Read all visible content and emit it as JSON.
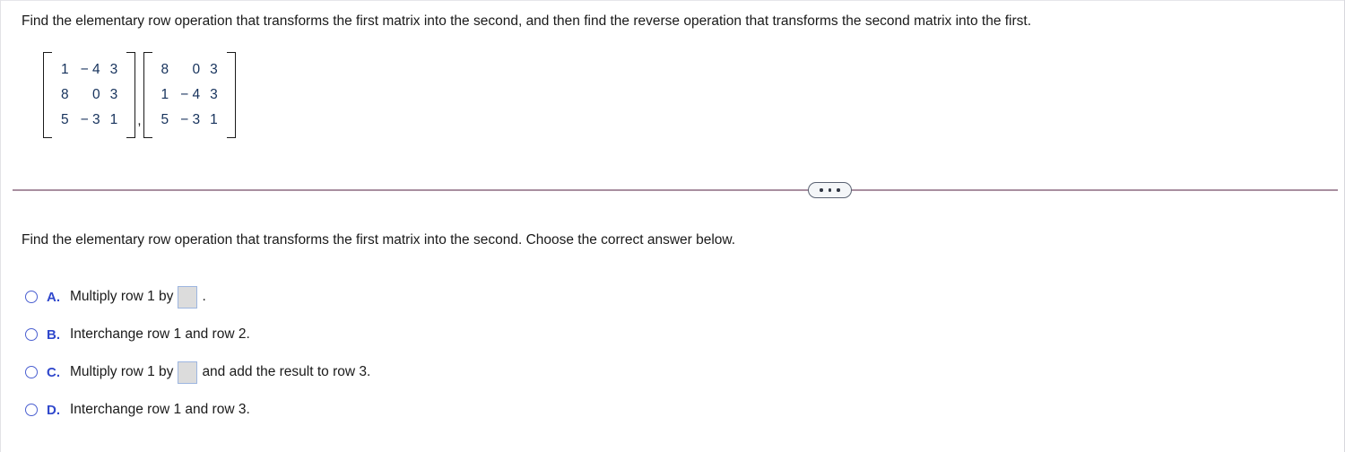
{
  "problem": {
    "stem": "Find the elementary row operation that transforms the first matrix into the second, and then find the reverse operation that transforms the second matrix into the first.",
    "matrices": [
      {
        "name": "first-matrix",
        "rows": [
          [
            "1",
            "− 4",
            "3"
          ],
          [
            "8",
            "0",
            "3"
          ],
          [
            "5",
            "− 3",
            "1"
          ]
        ]
      },
      {
        "name": "second-matrix",
        "rows": [
          [
            "8",
            "0",
            "3"
          ],
          [
            "1",
            "− 4",
            "3"
          ],
          [
            "5",
            "− 3",
            "1"
          ]
        ]
      }
    ],
    "separator": ","
  },
  "divider": {
    "ellipsis_label": "•••",
    "line_color": "#a98fa0"
  },
  "sub_question": {
    "text": "Find the elementary row operation that transforms the first matrix into the second. Choose the correct answer below."
  },
  "choices": [
    {
      "letter": "A.",
      "before": "Multiply row 1 by",
      "has_input": true,
      "input_value": "",
      "after": "."
    },
    {
      "letter": "B.",
      "before": "Interchange row 1 and row 2.",
      "has_input": false,
      "input_value": "",
      "after": ""
    },
    {
      "letter": "C.",
      "before": "Multiply row 1 by",
      "has_input": true,
      "input_value": "",
      "after": "and add the result to row 3."
    },
    {
      "letter": "D.",
      "before": "Interchange row 1 and row 3.",
      "has_input": false,
      "input_value": "",
      "after": ""
    }
  ],
  "colors": {
    "accent_blue": "#3048cc",
    "radio_blue": "#4a5fd0",
    "matrix_text": "#16325c",
    "input_fill": "#dcdcdc",
    "input_border": "#9db6e0"
  }
}
